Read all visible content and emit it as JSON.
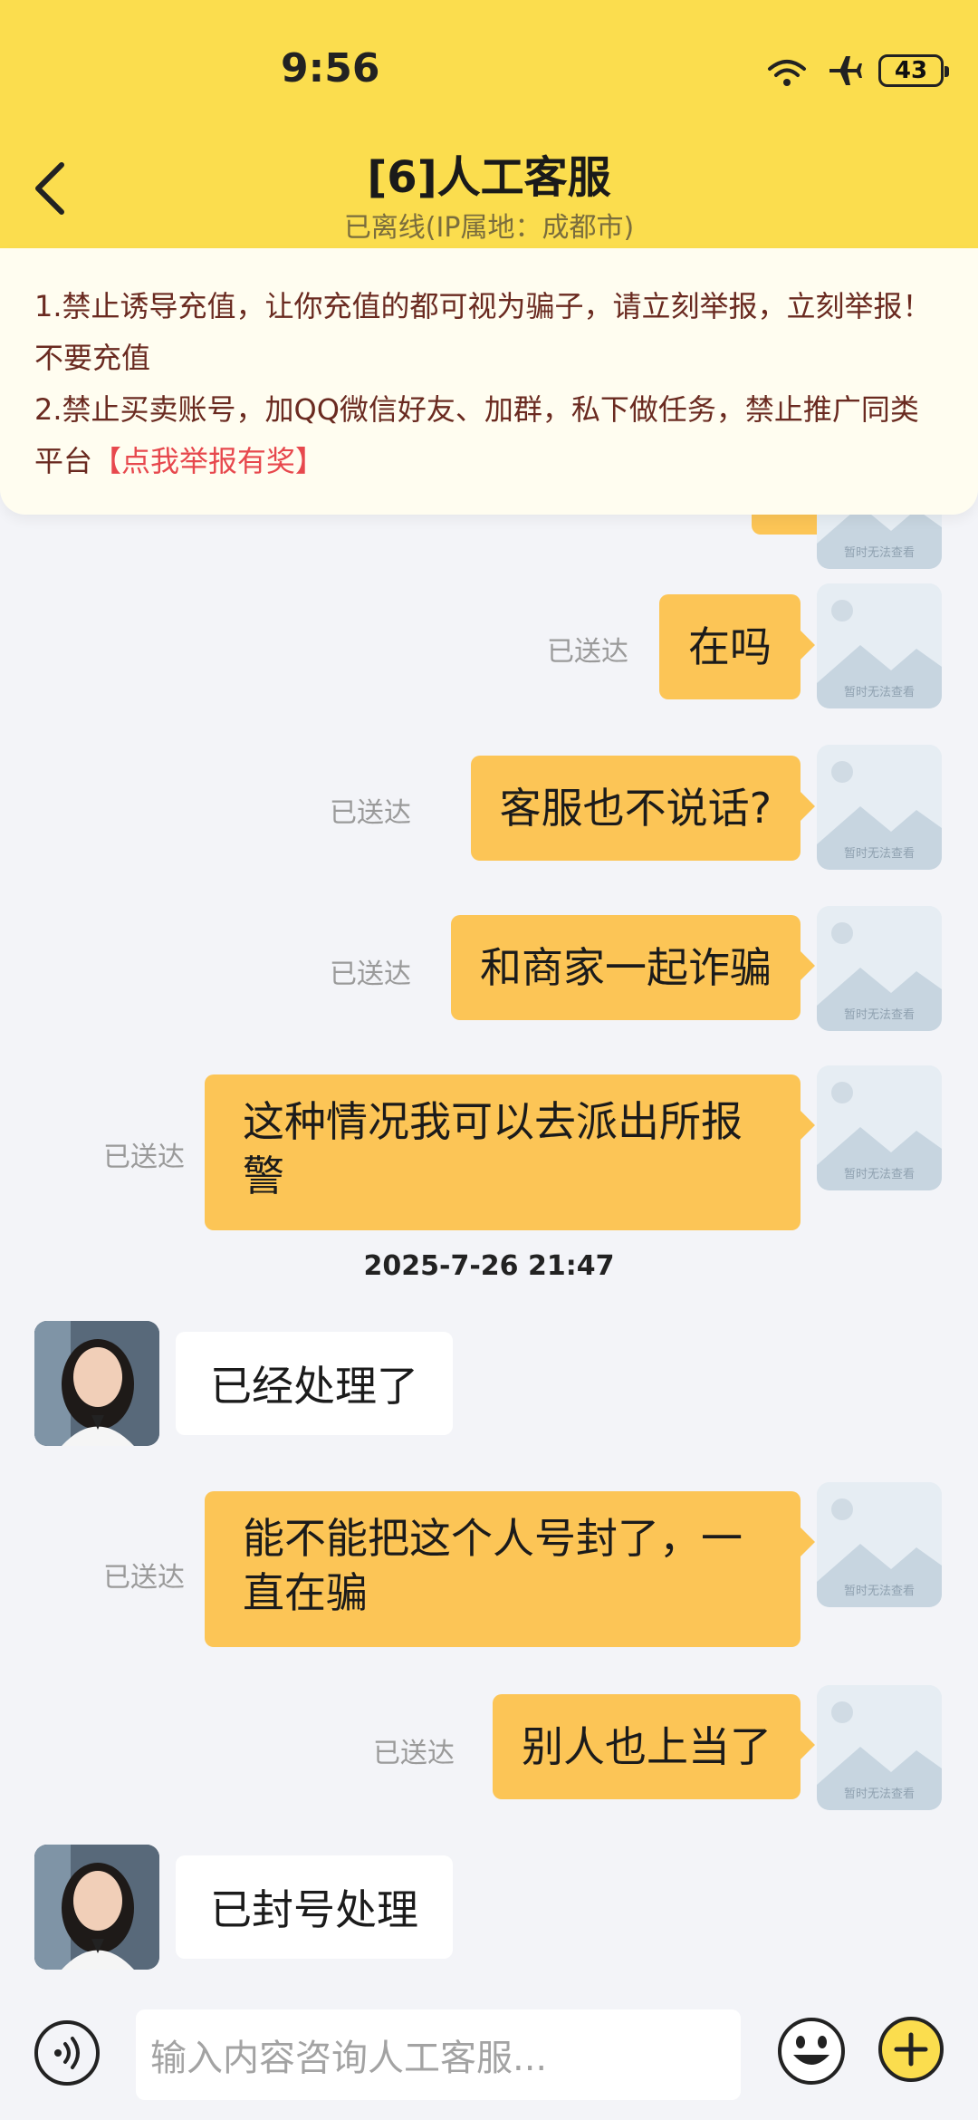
{
  "status_bar": {
    "time": "9:56",
    "battery": "43"
  },
  "header": {
    "title": "[6]人工客服",
    "subtitle": "已离线(IP属地：成都市)"
  },
  "notice": {
    "line1": "1.禁止诱导充值，让你充值的都可视为骗子，请立刻举报，立刻举报！不要充值",
    "line2_prefix": "2.禁止买卖账号，加QQ微信好友、加群，私下做任务，禁止推广同类平台",
    "report_link": "【点我举报有奖】"
  },
  "avatar_placeholder_text": "暂时无法查看",
  "messages": [
    {
      "side": "right",
      "text": "在吗",
      "status": "已送达"
    },
    {
      "side": "right",
      "text": "客服也不说话?",
      "status": "已送达"
    },
    {
      "side": "right",
      "text": "和商家一起诈骗",
      "status": "已送达"
    },
    {
      "side": "right",
      "text": "这种情况我可以去派出所报警",
      "status": "已送达"
    },
    {
      "side": "center",
      "text": "2025-7-26 21:47"
    },
    {
      "side": "left",
      "text": "已经处理了"
    },
    {
      "side": "right",
      "text": "能不能把这个人号封了，一直在骗",
      "status": "已送达"
    },
    {
      "side": "right",
      "text": "别人也上当了",
      "status": "已送达"
    },
    {
      "side": "left",
      "text": "已封号处理"
    }
  ],
  "input": {
    "placeholder": "输入内容咨询人工客服..."
  },
  "colors": {
    "header_bg": "#fbdd4e",
    "bubble_right": "#fcc556",
    "report_link": "#e7484d"
  }
}
